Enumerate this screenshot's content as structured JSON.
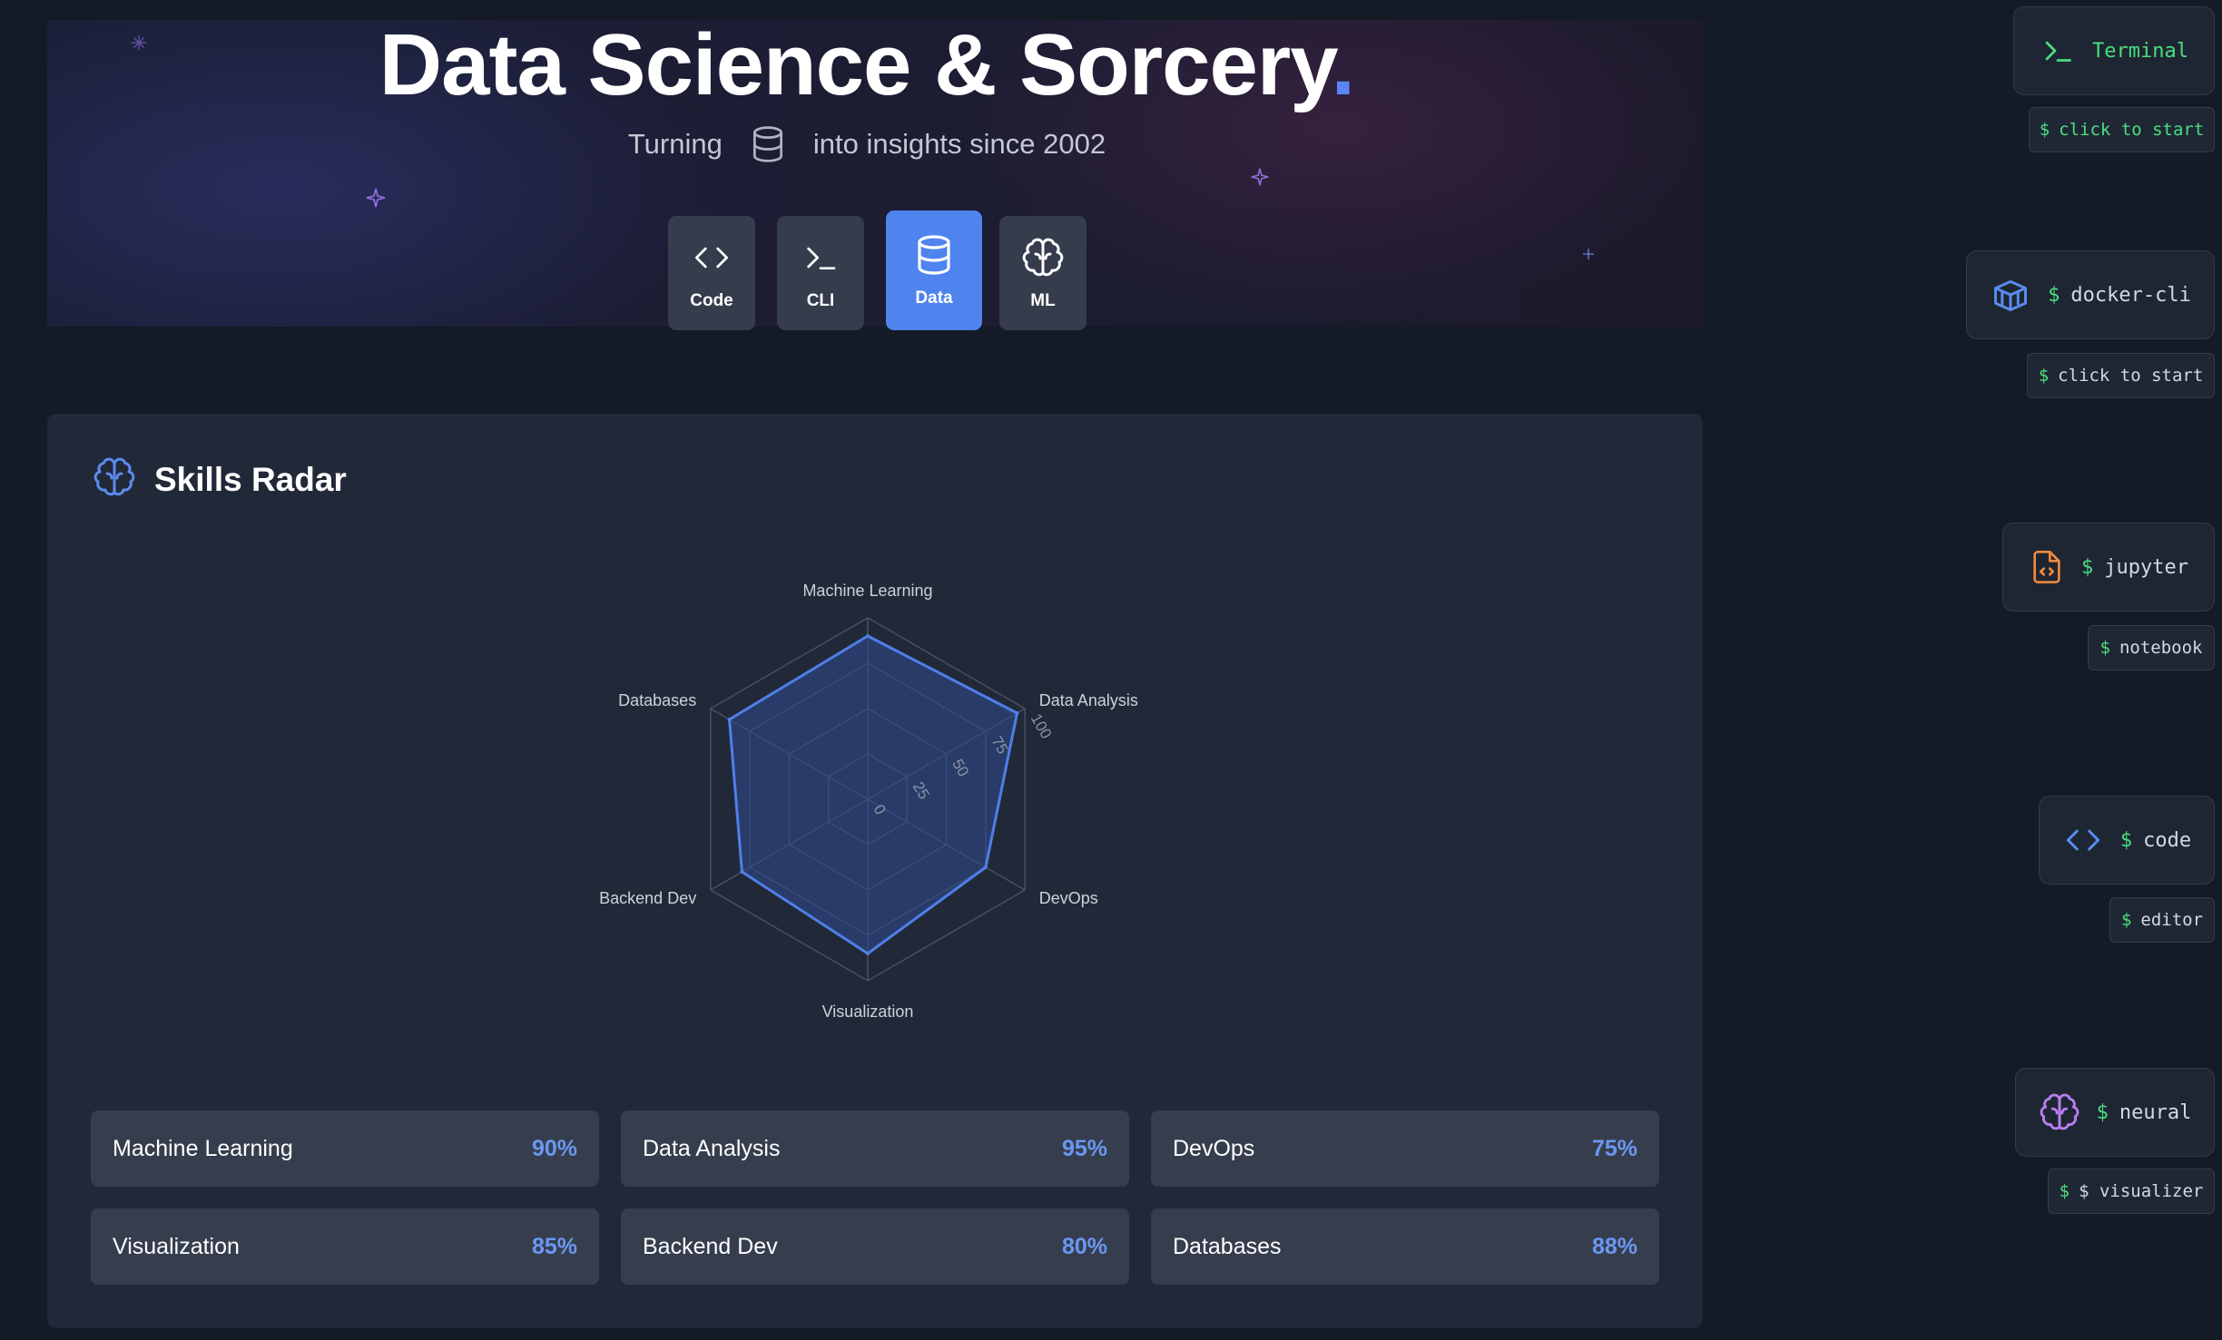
{
  "hero": {
    "title": "Data Science & Sorcery",
    "title_dot": ".",
    "subtitle_before": "Turning",
    "subtitle_icon": "database-icon",
    "subtitle_after": "into insights since 2002",
    "tabs": [
      {
        "label": "Code",
        "icon": "code-icon",
        "active": false
      },
      {
        "label": "CLI",
        "icon": "terminal-icon",
        "active": false
      },
      {
        "label": "Data",
        "icon": "database-icon",
        "active": true
      },
      {
        "label": "ML",
        "icon": "brain-icon",
        "active": false
      }
    ]
  },
  "skills_card": {
    "title": "Skills Radar",
    "icon": "brain-icon",
    "items": [
      {
        "name": "Machine Learning",
        "percent": "90%"
      },
      {
        "name": "Data Analysis",
        "percent": "95%"
      },
      {
        "name": "DevOps",
        "percent": "75%"
      },
      {
        "name": "Visualization",
        "percent": "85%"
      },
      {
        "name": "Backend Dev",
        "percent": "80%"
      },
      {
        "name": "Databases",
        "percent": "88%"
      }
    ]
  },
  "chart_data": {
    "type": "radar",
    "axes": [
      "Machine Learning",
      "Data Analysis",
      "DevOps",
      "Visualization",
      "Backend Dev",
      "Databases"
    ],
    "values": [
      90,
      95,
      75,
      85,
      80,
      88
    ],
    "ticks": [
      "0",
      "25",
      "50",
      "75",
      "100"
    ],
    "range": [
      0,
      100
    ],
    "grid": true,
    "colors": {
      "line": "#4f7fe8",
      "fill": "#2f4a8a",
      "grid": "#4a5263"
    }
  },
  "sidebar": {
    "items": [
      {
        "label": "Terminal",
        "dollar": "",
        "icon": "terminal-icon",
        "tip_dollar": "$",
        "tip": "click to start"
      },
      {
        "label": "docker-cli",
        "dollar": "$",
        "icon": "container-icon",
        "tip_dollar": "$",
        "tip": "click to start"
      },
      {
        "label": "jupyter",
        "dollar": "$",
        "icon": "file-code-icon",
        "tip_dollar": "$",
        "tip": "notebook"
      },
      {
        "label": "code",
        "dollar": "$",
        "icon": "code-icon",
        "tip_dollar": "$",
        "tip": "editor"
      },
      {
        "label": "neural",
        "dollar": "$",
        "icon": "brain-icon",
        "tip_dollar": "$",
        "tip": "$ visualizer"
      }
    ]
  },
  "colors": {
    "background": "#141a26",
    "accent": "#4f84ef",
    "terminal_green": "#4ade80"
  }
}
